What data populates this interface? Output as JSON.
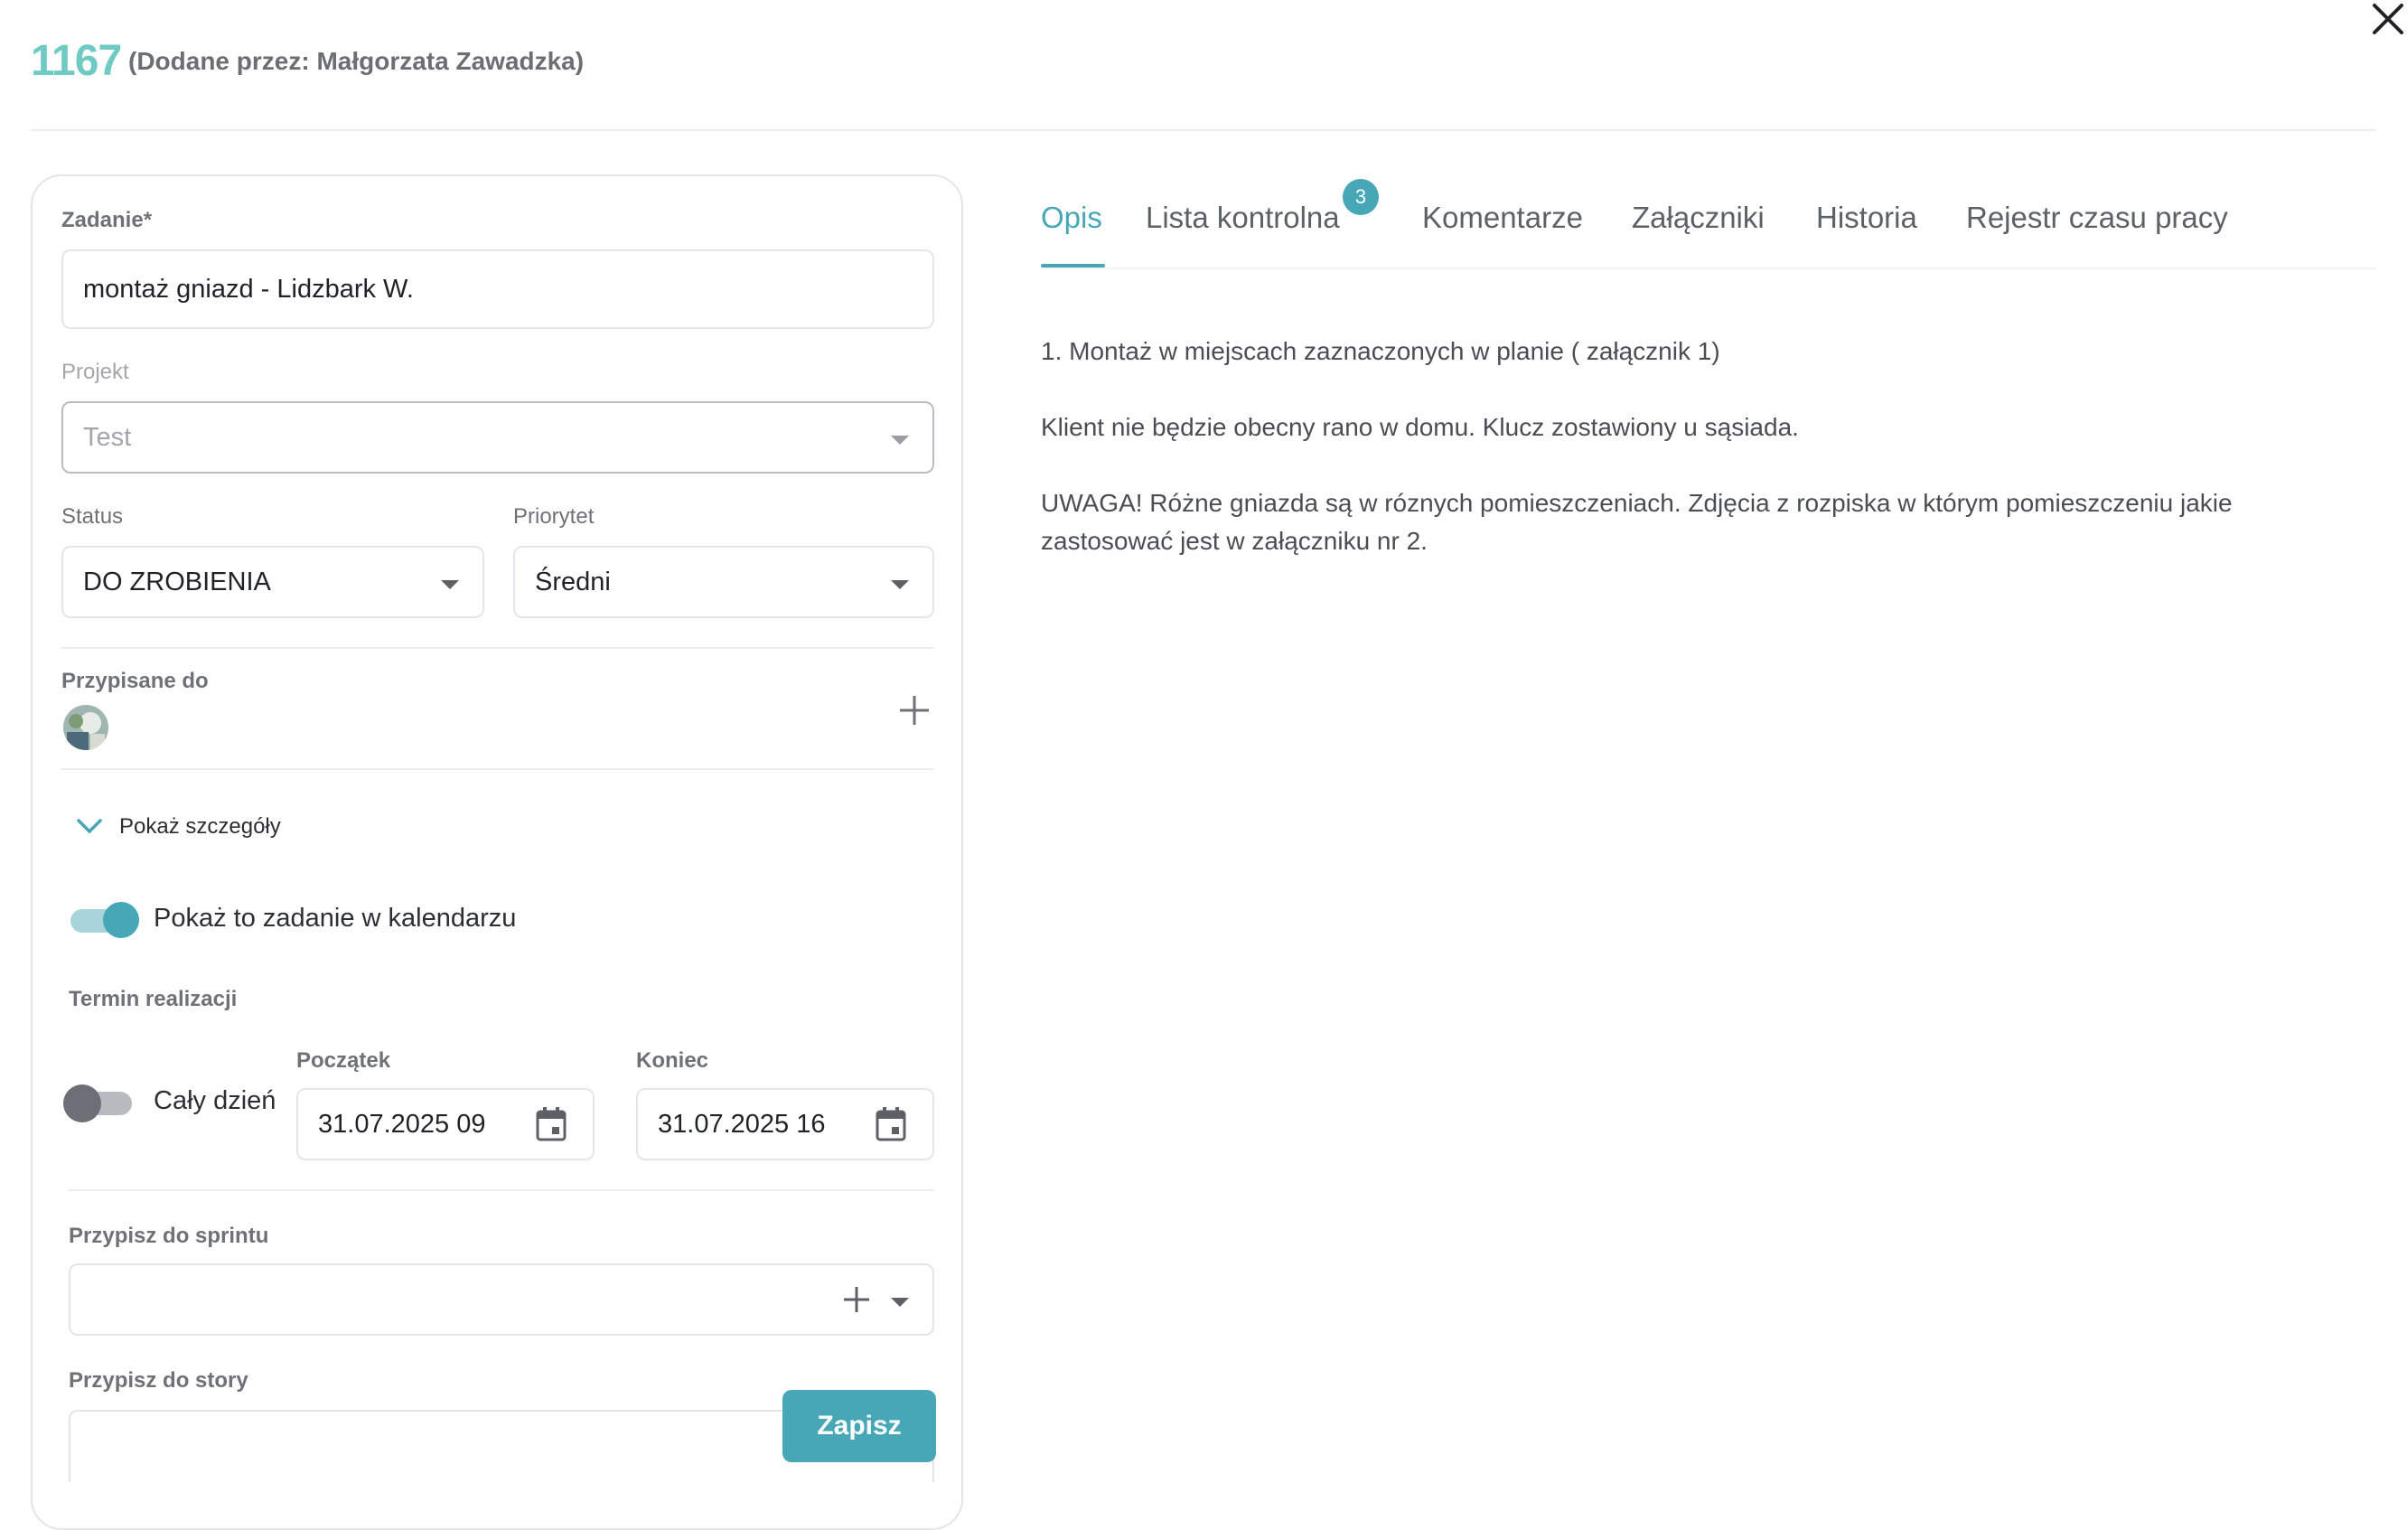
{
  "header": {
    "task_id": "1167",
    "added_by": "(Dodane przez: Małgorzata Zawadzka)"
  },
  "form": {
    "task_label": "Zadanie*",
    "task_value": "montaż gniazd - Lidzbark W.",
    "project_label": "Projekt",
    "project_value": "Test",
    "status_label": "Status",
    "status_value": "DO ZROBIENIA",
    "priority_label": "Priorytet",
    "priority_value": "Średni",
    "assigned_label": "Przypisane do",
    "show_details_label": "Pokaż szczegóły",
    "calendar_toggle_label": "Pokaż to zadanie w kalendarzu",
    "calendar_toggle_on": true,
    "deadline_label": "Termin realizacji",
    "all_day_label": "Cały dzień",
    "all_day_on": false,
    "start_label": "Początek",
    "start_value": "31.07.2025 09",
    "end_label": "Koniec",
    "end_value": "31.07.2025 16",
    "sprint_label": "Przypisz do sprintu",
    "sprint_value": "",
    "story_label": "Przypisz do story",
    "save_label": "Zapisz"
  },
  "tabs": [
    {
      "label": "Opis",
      "active": true
    },
    {
      "label": "Lista kontrolna",
      "badge": "3"
    },
    {
      "label": "Komentarze"
    },
    {
      "label": "Załączniki"
    },
    {
      "label": "Historia"
    },
    {
      "label": "Rejestr czasu pracy"
    }
  ],
  "description": {
    "line1": "1. Montaż w miejscach zaznaczonych w planie ( załącznik 1)",
    "line2": "Klient nie będzie obecny rano w domu. Klucz zostawiony u sąsiada.",
    "line3a": "UWAGA! Różne gniazda są w róznych pomieszczeniach. Zdjęcia z rozpiska w którym pomieszczeniu jakie",
    "line3b": "zastosować jest w załączniku nr 2."
  },
  "colors": {
    "accent": "#47a7b7",
    "id_color": "#6fcac4"
  },
  "icons": [
    "close-icon",
    "chevron-down-icon",
    "plus-icon",
    "calendar-icon",
    "caret-down-icon"
  ]
}
